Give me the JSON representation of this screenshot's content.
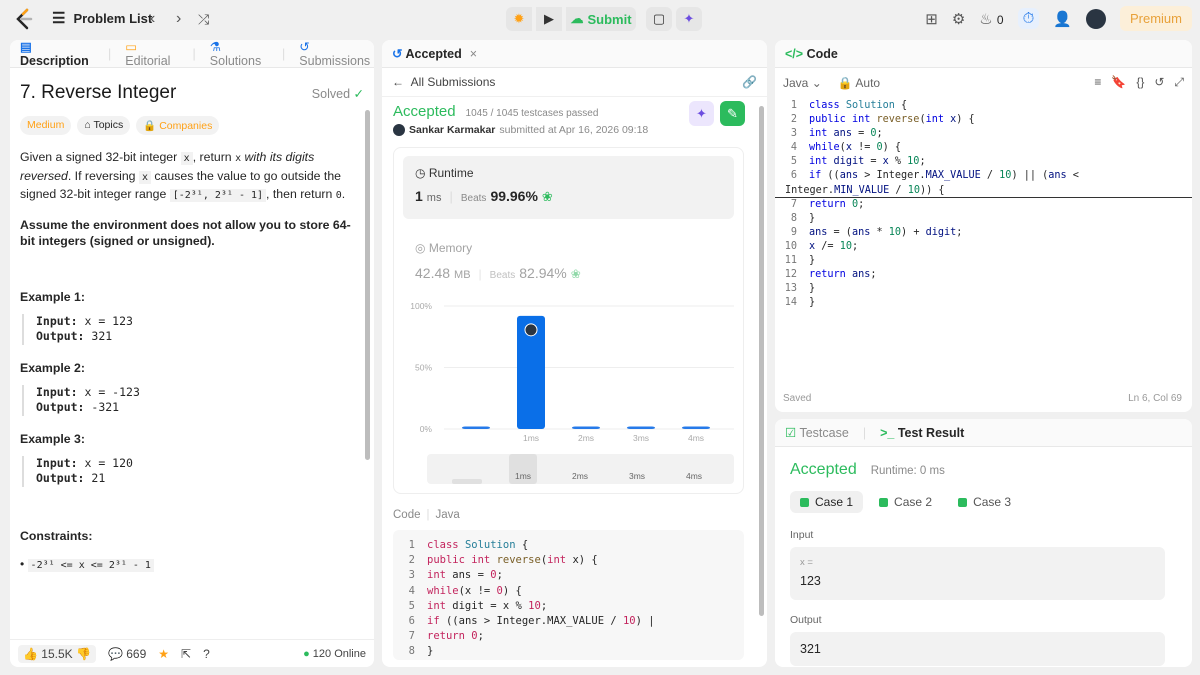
{
  "topbar": {
    "problem_list": "Problem List",
    "submit": "Submit",
    "streak": "0",
    "premium": "Premium"
  },
  "left": {
    "tabs": [
      "Description",
      "Editorial",
      "Solutions",
      "Submissions"
    ],
    "title": "7. Reverse Integer",
    "solved": "Solved",
    "difficulty": "Medium",
    "topics": "Topics",
    "companies": "Companies",
    "desc1": "Given a signed 32-bit integer",
    "desc_x": "x",
    "desc2": ", return",
    "desc_x2": "x",
    "desc3": "with its digits reversed",
    "desc4": ". If reversing",
    "desc_x3": "x",
    "desc5": "causes the value to go outside the signed 32-bit integer range",
    "desc_range": "[-2³¹, 2³¹ - 1]",
    "desc6": ", then return",
    "desc_zero": "0",
    "desc7": ".",
    "assume": "Assume the environment does not allow you to store 64-bit integers (signed or unsigned).",
    "examples": [
      {
        "title": "Example 1:",
        "input": "x = 123",
        "output": "321"
      },
      {
        "title": "Example 2:",
        "input": "x = -123",
        "output": "-321"
      },
      {
        "title": "Example 3:",
        "input": "x = 120",
        "output": "21"
      }
    ],
    "input_label": "Input:",
    "output_label": "Output:",
    "constraints_title": "Constraints:",
    "constraint": "-2³¹ <= x <= 2³¹ - 1",
    "likes": "15.5K",
    "comments": "669",
    "online": "120 Online"
  },
  "mid": {
    "tab": "Accepted",
    "all_submissions": "All Submissions",
    "status": "Accepted",
    "testcases": "1045 / 1045 testcases passed",
    "user": "Sankar Karmakar",
    "submitted": "submitted at Apr 16, 2026 09:18",
    "runtime_label": "Runtime",
    "runtime_value": "1",
    "runtime_unit": "ms",
    "beats_label": "Beats",
    "runtime_beats": "99.96%",
    "memory_label": "Memory",
    "memory_value": "42.48",
    "memory_unit": "MB",
    "memory_beats": "82.94%",
    "chart_data": {
      "type": "bar",
      "y_ticks": [
        "100%",
        "50%",
        "0%"
      ],
      "categories": [
        "",
        "1ms",
        "2ms",
        "3ms",
        "4ms"
      ],
      "values": [
        2,
        92,
        2,
        2,
        2
      ],
      "ylim": [
        0,
        100
      ],
      "highlight": "1ms",
      "mini_labels": [
        "1ms",
        "2ms",
        "3ms",
        "4ms"
      ]
    },
    "code_label": "Code",
    "lang": "Java"
  },
  "right": {
    "code_title": "Code",
    "lang": "Java",
    "auto": "Auto",
    "saved": "Saved",
    "cursor": "Ln 6, Col 69",
    "tabs": [
      "Testcase",
      "Test Result"
    ],
    "result": "Accepted",
    "runtime": "Runtime: 0 ms",
    "cases": [
      "Case 1",
      "Case 2",
      "Case 3"
    ],
    "input_label": "Input",
    "var": "x =",
    "input_val": "123",
    "output_label": "Output",
    "output_val": "321"
  },
  "colors": {
    "green": "#2cbb5d",
    "blue": "#1a73e8",
    "orange": "#ffa116"
  }
}
